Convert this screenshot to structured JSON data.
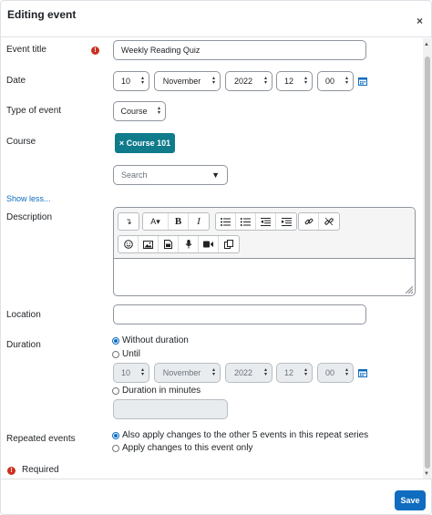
{
  "dialog": {
    "title": "Editing event",
    "close_glyph": "×"
  },
  "form": {
    "event_title": {
      "label": "Event title",
      "value": "Weekly Reading Quiz",
      "required_glyph": "!"
    },
    "date": {
      "label": "Date",
      "day": "10",
      "month": "November",
      "year": "2022",
      "hour": "12",
      "minute": "00"
    },
    "type_of_event": {
      "label": "Type of event",
      "value": "Course"
    },
    "course": {
      "label": "Course",
      "selected": "× Course 101",
      "search_placeholder": "Search",
      "search_caret": "▼"
    },
    "show_less": "Show less...",
    "description": {
      "label": "Description",
      "toolbar_icons": [
        "insert-icon",
        "font-size-icon",
        "bold-icon",
        "italic-icon",
        "unordered-list-icon",
        "ordered-list-icon",
        "outdent-icon",
        "indent-icon",
        "link-icon",
        "unlink-icon",
        "emoji-icon",
        "image-icon",
        "media-icon",
        "record-audio-icon",
        "record-video-icon",
        "manage-files-icon"
      ],
      "bold_label": "B",
      "italic_label": "I",
      "font_label": "A▾"
    },
    "location": {
      "label": "Location",
      "value": ""
    },
    "duration": {
      "label": "Duration",
      "options": [
        "Without duration",
        "Until",
        "Duration in minutes"
      ],
      "selected_index": 0,
      "until": {
        "day": "10",
        "month": "November",
        "year": "2022",
        "hour": "12",
        "minute": "00"
      },
      "minutes_value": ""
    },
    "repeated_events": {
      "label": "Repeated events",
      "options": [
        "Also apply changes to the other 5 events in this repeat series",
        "Apply changes to this event only"
      ],
      "selected_index": 0
    },
    "required_note": "Required"
  },
  "footer": {
    "save_label": "Save"
  },
  "colors": {
    "accent": "#0f6cbf",
    "course_badge": "#0f7b8b",
    "required": "#ca3120"
  }
}
